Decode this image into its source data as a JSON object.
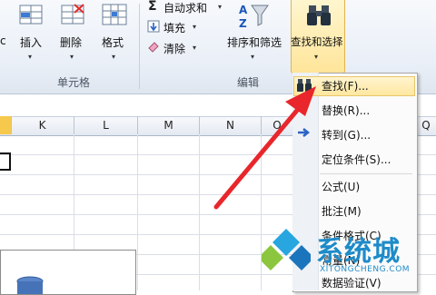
{
  "ribbon": {
    "cells_group_label": "单元格",
    "editing_group_label": "编辑",
    "insert_label": "插入",
    "delete_label": "删除",
    "format_label": "格式",
    "autosum_label": "自动求和",
    "fill_label": "填充",
    "clear_label": "清除",
    "sort_filter_label": "排序和筛选",
    "find_select_label": "查找和选择",
    "sigma_glyph": "Σ",
    "dropdown_glyph": "▾",
    "partial_left_glyph": "c"
  },
  "columns": [
    "K",
    "L",
    "M",
    "N",
    "O",
    "Q"
  ],
  "menu": {
    "items": [
      {
        "label": "查找(F)...",
        "icon": "binoculars-icon"
      },
      {
        "label": "替换(R)...",
        "icon": ""
      },
      {
        "label": "转到(G)...",
        "icon": "arrow-right-icon"
      },
      {
        "label": "定位条件(S)...",
        "icon": ""
      },
      {
        "label": "公式(U)",
        "icon": ""
      },
      {
        "label": "批注(M)",
        "icon": ""
      },
      {
        "label": "条件格式(C)",
        "icon": ""
      },
      {
        "label": "常量(N)",
        "icon": ""
      },
      {
        "label": "数据验证(V)",
        "icon": ""
      }
    ]
  },
  "watermark": {
    "text": "系统城",
    "subtext": "XITONGCHENG.COM"
  },
  "colors": {
    "accent_red": "#e8262b",
    "highlight": "#ffe7a0",
    "watermark_blue": "#1e8bc9"
  }
}
